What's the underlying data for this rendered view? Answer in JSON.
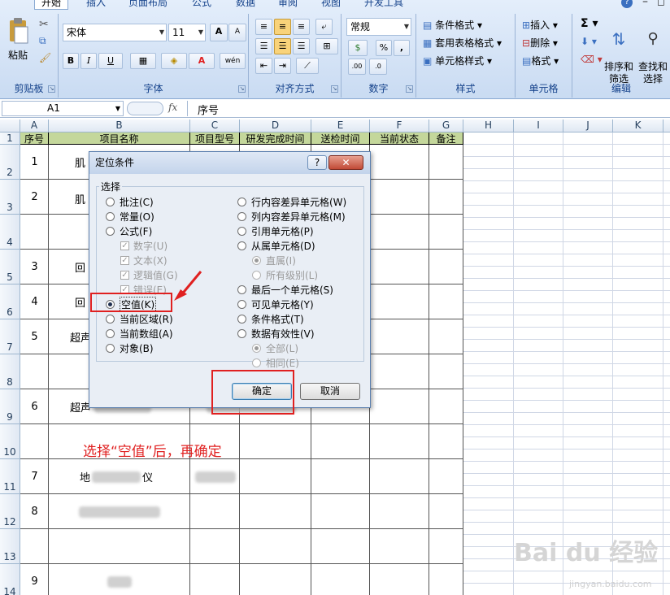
{
  "ribbon": {
    "tabs": [
      "开始",
      "插入",
      "页面布局",
      "公式",
      "数据",
      "审阅",
      "视图",
      "开发工具"
    ],
    "clipboard": {
      "paste": "粘贴",
      "group": "剪贴板"
    },
    "font": {
      "name": "宋体",
      "size": "11",
      "bold": "B",
      "italic": "I",
      "underline": "U",
      "font_color_letter": "A",
      "phonetic": "wén",
      "grow": "A",
      "shrink": "A",
      "group": "字体"
    },
    "alignment": {
      "group": "对齐方式"
    },
    "number": {
      "format": "常规",
      "percent": "%",
      "comma": ",",
      "inc_decimal": ".00",
      "dec_decimal": ".0",
      "group": "数字"
    },
    "styles": {
      "conditional": "条件格式",
      "table": "套用表格格式",
      "cell": "单元格样式",
      "group": "样式"
    },
    "cells": {
      "insert": "插入",
      "delete": "删除",
      "format": "格式",
      "group": "单元格"
    },
    "editing": {
      "sum": "Σ",
      "sort": "排序和\n筛选",
      "find": "查找和\n选择",
      "group": "编辑"
    }
  },
  "formula_bar": {
    "name_box": "A1",
    "fx": "fx",
    "content": "序号"
  },
  "columns": [
    "A",
    "B",
    "C",
    "D",
    "E",
    "F",
    "G",
    "H",
    "I",
    "J",
    "K"
  ],
  "rows": [
    "1",
    "2",
    "3",
    "4",
    "5",
    "6",
    "7",
    "8",
    "9",
    "10",
    "11",
    "12",
    "13",
    "14"
  ],
  "headers": [
    "序号",
    "项目名称",
    "项目型号",
    "研发完成时间",
    "送检时间",
    "当前状态",
    "备注"
  ],
  "table": {
    "r2": {
      "num": "1",
      "name": "肌"
    },
    "r3": {
      "num": "2",
      "name": "肌"
    },
    "r5": {
      "num": "3",
      "name": "回"
    },
    "r6": {
      "num": "4",
      "name": "回"
    },
    "r7": {
      "num": "5",
      "name": "超声"
    },
    "r9": {
      "num": "6",
      "name": "超声"
    },
    "r11": {
      "num": "7",
      "name_a": "地",
      "name_b": "仪"
    },
    "r12": {
      "num": "8"
    },
    "r14": {
      "num": "9"
    }
  },
  "dialog": {
    "title": "定位条件",
    "help": "?",
    "close": "✕",
    "group": "选择",
    "left_options": [
      "批注(C)",
      "常量(O)",
      "公式(F)",
      "当前区域(R)",
      "当前数组(A)",
      "对象(B)"
    ],
    "formula_subs": [
      "数字(U)",
      "文本(X)",
      "逻辑值(G)",
      "错误(E)"
    ],
    "blanks": "空值(K)",
    "right_options": [
      "行内容差异单元格(W)",
      "列内容差异单元格(M)",
      "引用单元格(P)",
      "从属单元格(D)",
      "最后一个单元格(S)",
      "可见单元格(Y)",
      "条件格式(T)",
      "数据有效性(V)"
    ],
    "dependents_subs": [
      "直属(I)",
      "所有级别(L)"
    ],
    "validation_subs": [
      "全部(L)",
      "相同(E)"
    ],
    "ok": "确定",
    "cancel": "取消"
  },
  "annotation": "选择“空值”后，再确定",
  "watermark": {
    "main": "Bai du 经验",
    "sub": "jingyan.baidu.com"
  },
  "colors": {
    "header_fill": "#c4d79b",
    "annotation_red": "#e02020",
    "ribbon_blue": "#c9dbf2"
  }
}
